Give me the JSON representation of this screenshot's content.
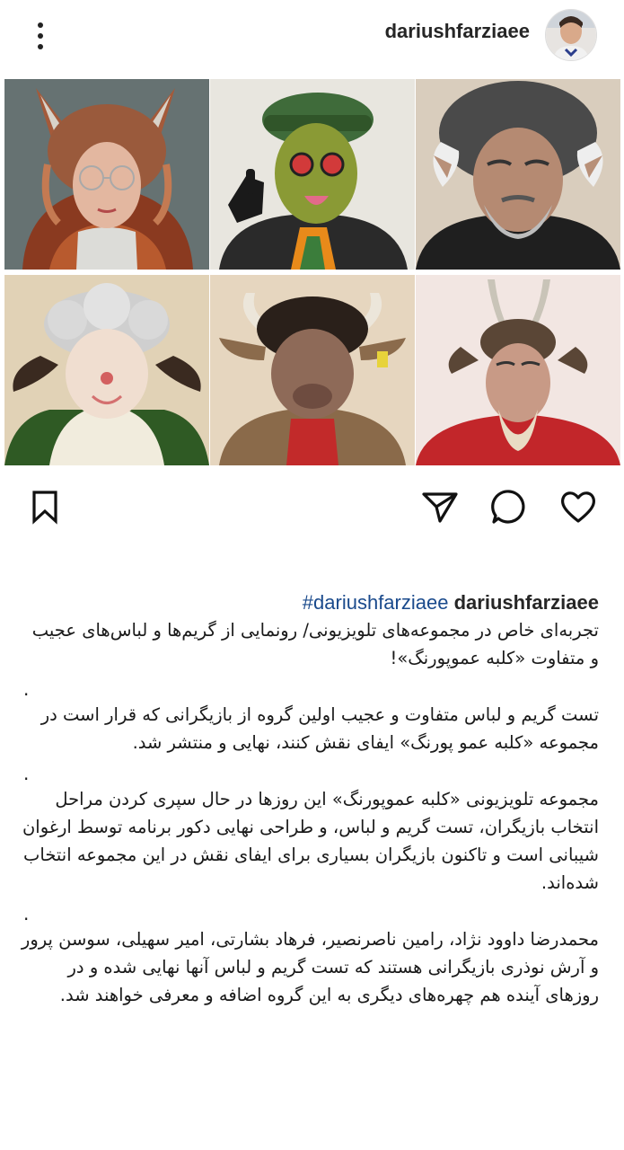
{
  "header": {
    "username": "dariushfarziaee",
    "more_icon": "more-vertical-icon",
    "avatar_icon": "profile-avatar"
  },
  "photos": [
    {
      "label": "fox-character-photo"
    },
    {
      "label": "green-goblin-character-photo"
    },
    {
      "label": "bearded-troll-character-photo"
    },
    {
      "label": "sheep-character-photo"
    },
    {
      "label": "bull-character-photo"
    },
    {
      "label": "goat-character-photo"
    }
  ],
  "actions": {
    "like_icon": "heart-icon",
    "comment_icon": "comment-icon",
    "share_icon": "send-icon",
    "save_icon": "bookmark-icon"
  },
  "caption": {
    "username": "dariushfarziaee",
    "hashtag": "#dariushfarziaee",
    "p1": "تجربه‌ای خاص در مجموعه‌های تلویزیونی/ رونمایی از گریم‌ها و لباس‌های عجیب و متفاوت «کلبه عموپورنگ»!",
    "dot1": ".",
    "p2": "تست گریم و لباس متفاوت و عجیب اولین گروه از بازیگرانی که قرار است در مجموعه «کلبه عمو پورنگ» ایفای نقش کنند، نهایی و منتشر شد.",
    "dot2": ".",
    "p3": "مجموعه تلویزیونی «کلبه عموپورنگ» این روزها در حال سپری کردن مراحل انتخاب بازیگران، تست گریم و لباس، و طراحی نهایی دکور برنامه توسط ارغوان شیبانی است و تاکنون بازیگران بسیاری برای ایفای نقش در این مجموعه انتخاب شده‌اند.",
    "dot3": ".",
    "p4": "محمدرضا داوود نژاد، رامین ناصرنصیر، فرهاد بشارتی، امیر سهیلی، سوسن پرور و آرش نوذری بازیگرانی هستند که تست گریم و لباس آنها نهایی شده و در روزهای آینده هم چهره‌های دیگری به این گروه اضافه و معرفی خواهند شد."
  },
  "colors": {
    "hashtag": "#1a4a8c",
    "text": "#1a1a1a"
  }
}
